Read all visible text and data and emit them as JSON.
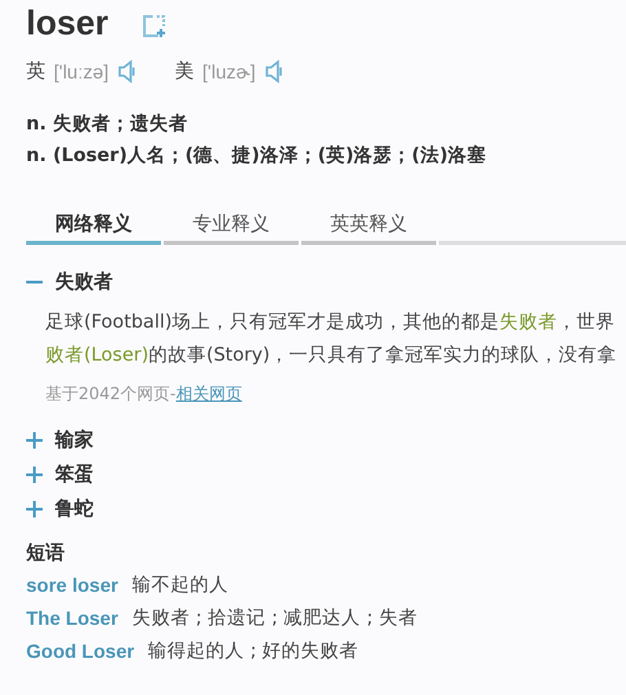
{
  "headword": "loser",
  "pronunciations": [
    {
      "region": "英",
      "phonetic": "['luːzə]"
    },
    {
      "region": "美",
      "phonetic": "['luzɚ]"
    }
  ],
  "definitions": [
    "n. 失败者；遗失者",
    "n. (Loser)人名；(德、捷)洛泽；(英)洛瑟；(法)洛塞"
  ],
  "tabs": [
    {
      "label": "网络释义",
      "selected": true
    },
    {
      "label": "专业释义",
      "selected": false
    },
    {
      "label": "英英释义",
      "selected": false
    }
  ],
  "senses": [
    {
      "title": "失败者",
      "expanded": true,
      "example_lines": [
        [
          {
            "text": "足球(Football)场上，只有冠军才是成功，其他的都是",
            "highlight": false
          },
          {
            "text": "失败者",
            "highlight": true
          },
          {
            "text": "，世界",
            "highlight": false
          }
        ],
        [
          {
            "text": "败者",
            "highlight": true
          },
          {
            "text": "(Loser)",
            "highlight": true
          },
          {
            "text": "的故事(Story)，一只具有了拿冠军实力的球队，没有拿",
            "highlight": false
          }
        ]
      ],
      "source": "基于2042个网页-",
      "source_link": "相关网页"
    },
    {
      "title": "输家",
      "expanded": false
    },
    {
      "title": "笨蛋",
      "expanded": false
    },
    {
      "title": "鲁蛇",
      "expanded": false
    }
  ],
  "phrases_heading": "短语",
  "phrases": [
    {
      "phrase": "sore loser",
      "meaning": "输不起的人"
    },
    {
      "phrase": "The Loser",
      "meaning": "失败者 ; 拾遗记 ; 减肥达人 ; 失者"
    },
    {
      "phrase": "Good Loser",
      "meaning": "输得起的人 ; 好的失败者"
    }
  ]
}
